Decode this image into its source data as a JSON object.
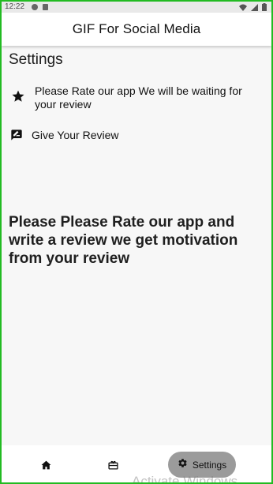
{
  "status_bar": {
    "time": "12:22"
  },
  "app_bar": {
    "title": "GIF For Social Media"
  },
  "page": {
    "heading": "Settings"
  },
  "settings_items": [
    {
      "icon": "star-icon",
      "label": "Please Rate our app We will be waiting for your review"
    },
    {
      "icon": "rate-review-icon",
      "label": "Give Your Review"
    }
  ],
  "message": "Please Please Rate our app and write a review we get motivation from your review",
  "bottom_nav": {
    "items": [
      {
        "icon": "home-icon",
        "label": ""
      },
      {
        "icon": "cards-icon",
        "label": ""
      },
      {
        "icon": "gear-icon",
        "label": "Settings",
        "selected": true
      }
    ]
  },
  "watermark": "Activate Windows",
  "colors": {
    "frame": "#22bb22",
    "background": "#f7f7f7",
    "app_bar": "#ffffff",
    "selected_nav_pill": "#9b9b9b"
  }
}
